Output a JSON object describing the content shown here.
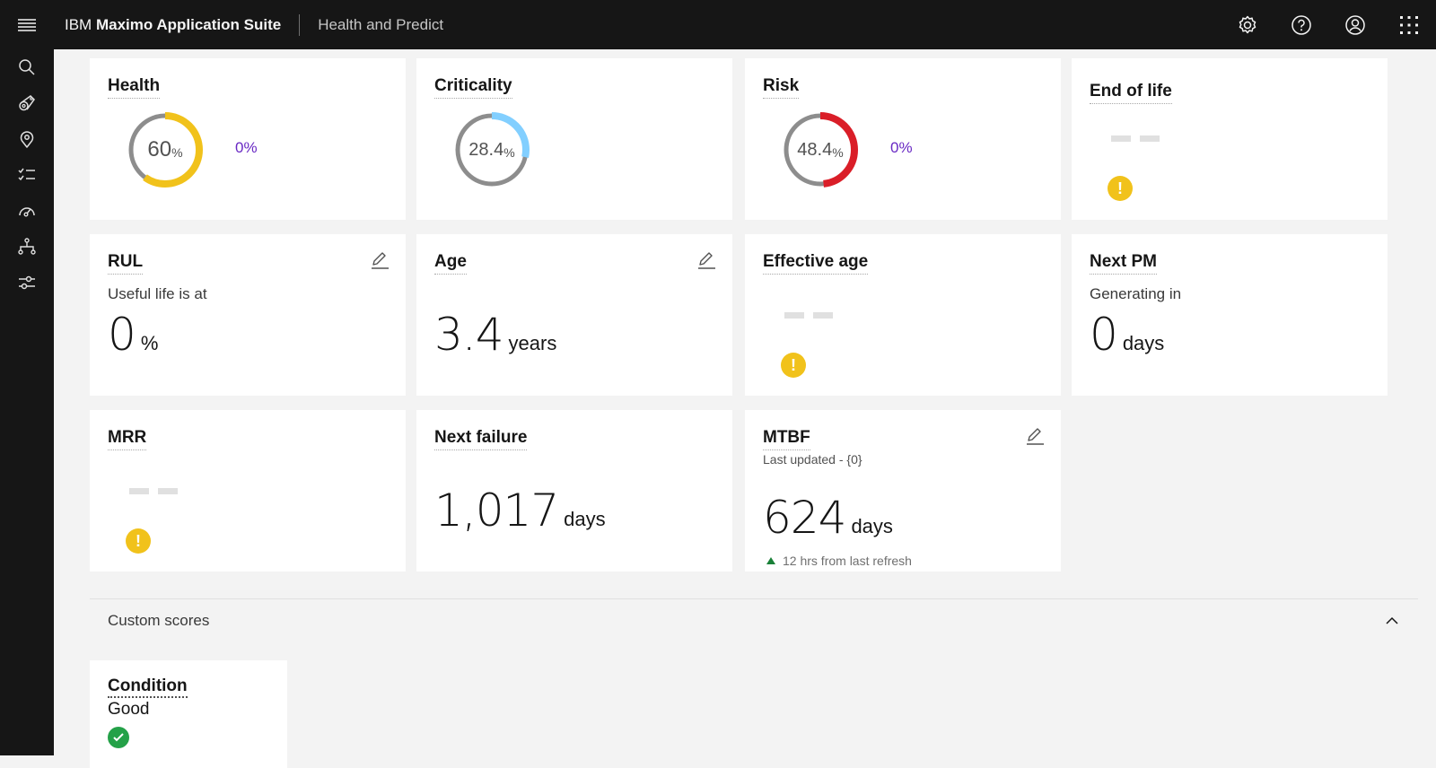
{
  "header": {
    "brand_prefix": "IBM",
    "brand_name": "Maximo Application Suite",
    "app_name": "Health and Predict",
    "icons": [
      "menu-icon",
      "settings-icon",
      "help-icon",
      "user-icon",
      "app-switcher-icon"
    ]
  },
  "sidenav": {
    "items": [
      "search-icon",
      "asset-icon",
      "location-icon",
      "checklist-icon",
      "gauge-icon",
      "hierarchy-icon",
      "settings-sliders-icon"
    ]
  },
  "cards": {
    "health": {
      "title": "Health",
      "value": "60",
      "unit": "%",
      "fraction": 0.6,
      "color": "#f1c21b",
      "trend": "0%"
    },
    "criticality": {
      "title": "Criticality",
      "value": "28.4",
      "unit": "%",
      "fraction": 0.284,
      "color": "#82cfff"
    },
    "risk": {
      "title": "Risk",
      "value": "48.4",
      "unit": "%",
      "fraction": 0.484,
      "color": "#da1e28",
      "trend": "0%"
    },
    "end_of_life": {
      "title": "End of life",
      "value": "--"
    },
    "rul": {
      "title": "RUL",
      "subtitle": "Useful life is at",
      "value": "0",
      "unit": "%"
    },
    "age": {
      "title": "Age",
      "value": "3.4",
      "unit": "years"
    },
    "effective_age": {
      "title": "Effective age",
      "value": "--"
    },
    "next_pm": {
      "title": "Next PM",
      "subtitle": "Generating in",
      "value": "0",
      "unit": "days"
    },
    "mrr": {
      "title": "MRR",
      "value": "--"
    },
    "next_failure": {
      "title": "Next failure",
      "value": "1,017",
      "unit": "days"
    },
    "mtbf": {
      "title": "MTBF",
      "subtitle": "Last updated - {0}",
      "value": "624",
      "unit": "days",
      "refresh": "12 hrs from last refresh"
    }
  },
  "custom_scores": {
    "label": "Custom scores",
    "items": [
      {
        "title": "Condition",
        "value": "Good",
        "status": "ok"
      }
    ]
  }
}
